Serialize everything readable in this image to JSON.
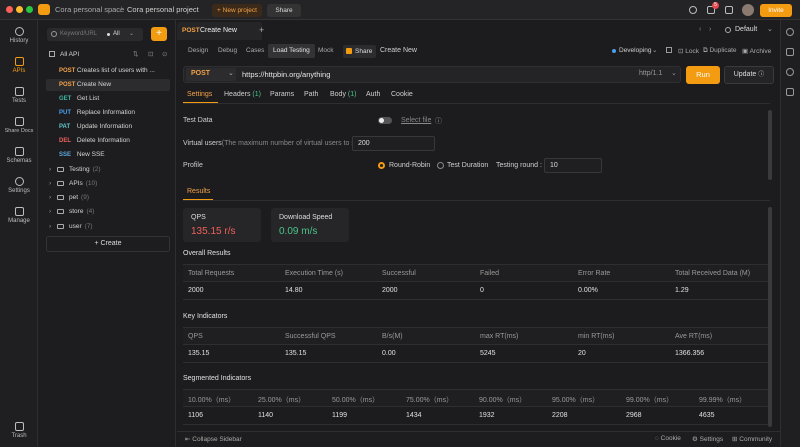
{
  "titlebar": {
    "space": "Cora personal space",
    "separator": "/",
    "project": "Cora personal project",
    "new_project": "+ New project",
    "share": "Share",
    "notification_count": "5",
    "invite": "Invite"
  },
  "leftnav": {
    "items": [
      {
        "label": "History"
      },
      {
        "label": "APIs"
      },
      {
        "label": "Tests"
      },
      {
        "label": "Share Docs"
      },
      {
        "label": "Schemas"
      },
      {
        "label": "Settings"
      },
      {
        "label": "Manage"
      }
    ],
    "trash": "Trash"
  },
  "tree": {
    "search_placeholder": "Keyword/URL",
    "filter": "All",
    "add": "+",
    "all_api": "All API",
    "endpoints": [
      {
        "method": "POST",
        "name": "Creates list of users with ..."
      },
      {
        "method": "POST",
        "name": "Create New"
      },
      {
        "method": "GET",
        "name": "Get List"
      },
      {
        "method": "PUT",
        "name": "Replace Information"
      },
      {
        "method": "PAT",
        "name": "Update Information"
      },
      {
        "method": "DEL",
        "name": "Delete Information"
      },
      {
        "method": "SSE",
        "name": "New SSE"
      }
    ],
    "folders": [
      {
        "name": "Testing",
        "count": "(2)"
      },
      {
        "name": "APIs",
        "count": "(10)"
      },
      {
        "name": "pet",
        "count": "(9)"
      },
      {
        "name": "store",
        "count": "(4)"
      },
      {
        "name": "user",
        "count": "(7)"
      }
    ],
    "create": "+ Create",
    "collapse_sidebar": "Collapse Sidebar"
  },
  "tab": {
    "method": "POST",
    "title": "Create New",
    "add": "+"
  },
  "environment": "Default",
  "request_modes": [
    "Design",
    "Debug",
    "Cases",
    "Load Testing",
    "Mock"
  ],
  "request_header": {
    "share": "Share",
    "name": "Create New",
    "status": "Developing",
    "lock": "Lock",
    "duplicate": "Duplicate",
    "archive": "Archive"
  },
  "url": {
    "method": "POST",
    "value": "https://httpbin.org/anything",
    "protocol": "http/1.1",
    "run": "Run",
    "update": "Update"
  },
  "subtabs": [
    {
      "label": "Settings",
      "count": ""
    },
    {
      "label": "Headers",
      "count": "(1)"
    },
    {
      "label": "Params",
      "count": ""
    },
    {
      "label": "Path",
      "count": ""
    },
    {
      "label": "Body",
      "count": "(1)"
    },
    {
      "label": "Auth",
      "count": ""
    },
    {
      "label": "Cookie",
      "count": ""
    }
  ],
  "settings": {
    "test_data_label": "Test Data",
    "select_file": "Select file",
    "virtual_users_label": "Virtual users",
    "virtual_users_hint": "(The maximum number of virtual users to simulate)",
    "virtual_users_value": "200",
    "profile_label": "Profile",
    "round_robin": "Round-Robin",
    "test_duration": "Test Duration",
    "testing_round_label": "Testing round :",
    "testing_round_value": "10"
  },
  "results_tab": "Results",
  "cards": {
    "qps_label": "QPS",
    "qps_value": "135.15 r/s",
    "download_label": "Download Speed",
    "download_value": "0.09 m/s"
  },
  "overall": {
    "title": "Overall Results",
    "headers": [
      "Total Requests",
      "Execution Time (s)",
      "Successful",
      "Failed",
      "Error Rate",
      "Total Received Data (M)"
    ],
    "values": [
      "2000",
      "14.80",
      "2000",
      "0",
      "0.00%",
      "1.29"
    ]
  },
  "key": {
    "title": "Key Indicators",
    "headers": [
      "QPS",
      "Successful QPS",
      "B/s(M)",
      "max RT(ms)",
      "min RT(ms)",
      "Ave RT(ms)"
    ],
    "values": [
      "135.15",
      "135.15",
      "0.00",
      "5245",
      "20",
      "1366.356"
    ]
  },
  "segmented": {
    "title": "Segmented Indicators",
    "headers": [
      "10.00%（ms）",
      "25.00%（ms）",
      "50.00%（ms）",
      "75.00%（ms）",
      "90.00%（ms）",
      "95.00%（ms）",
      "99.00%（ms）",
      "99.99%（ms）"
    ],
    "values": [
      "1106",
      "1140",
      "1199",
      "1434",
      "1932",
      "2208",
      "2968",
      "4635"
    ]
  },
  "bottombar": {
    "cookie": "Cookie",
    "settings": "Settings",
    "community": "Community"
  },
  "colors": {
    "accent": "#f39c12",
    "qps": "#f0605a",
    "download": "#4cc38a"
  }
}
